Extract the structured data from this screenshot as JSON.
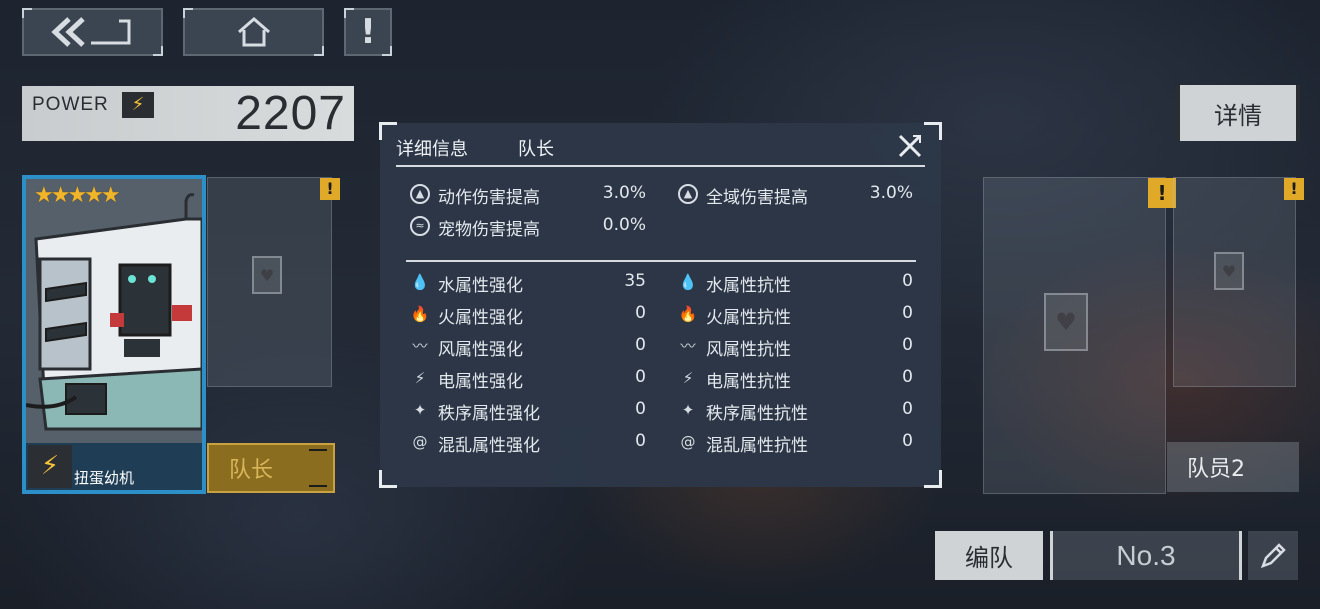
{
  "nav": {
    "back_icon": "double-chevron-back-icon",
    "home_icon": "home-icon",
    "alert_glyph": "!"
  },
  "power": {
    "label": "POWER",
    "value": "2207",
    "bolt": "⚡"
  },
  "detail_button": "详情",
  "character": {
    "name": "扭蛋幼机",
    "stars": "★★★★★",
    "rarity": 5,
    "element_icon": "lightning-icon"
  },
  "slots": {
    "leader_label": "队长",
    "member2_label": "队员2",
    "warn": "!"
  },
  "bottom": {
    "team_label": "编队",
    "team_number": "No.3",
    "edit_icon": "pencil-icon"
  },
  "modal": {
    "title": "详细信息",
    "subtitle": "队长",
    "stats_top": [
      {
        "label": "动作伤害提高",
        "value": "3.0%",
        "icon": "arrow-up-circle-icon"
      },
      {
        "label": "全域伤害提高",
        "value": "3.0%",
        "icon": "arrow-up-circle-icon"
      },
      {
        "label": "宠物伤害提高",
        "value": "0.0%",
        "icon": "pet-wing-icon"
      }
    ],
    "attributes_boost": [
      {
        "label": "水属性强化",
        "value": "35",
        "icon": "water-drop-icon"
      },
      {
        "label": "火属性强化",
        "value": "0",
        "icon": "fire-icon"
      },
      {
        "label": "风属性强化",
        "value": "0",
        "icon": "wind-icon"
      },
      {
        "label": "电属性强化",
        "value": "0",
        "icon": "lightning-icon"
      },
      {
        "label": "秩序属性强化",
        "value": "0",
        "icon": "order-star-icon"
      },
      {
        "label": "混乱属性强化",
        "value": "0",
        "icon": "chaos-spiral-icon"
      }
    ],
    "attributes_resist": [
      {
        "label": "水属性抗性",
        "value": "0",
        "icon": "water-resist-icon"
      },
      {
        "label": "火属性抗性",
        "value": "0",
        "icon": "fire-resist-icon"
      },
      {
        "label": "风属性抗性",
        "value": "0",
        "icon": "wind-resist-icon"
      },
      {
        "label": "电属性抗性",
        "value": "0",
        "icon": "lightning-resist-icon"
      },
      {
        "label": "秩序属性抗性",
        "value": "0",
        "icon": "order-resist-icon"
      },
      {
        "label": "混乱属性抗性",
        "value": "0",
        "icon": "chaos-resist-icon"
      }
    ]
  }
}
